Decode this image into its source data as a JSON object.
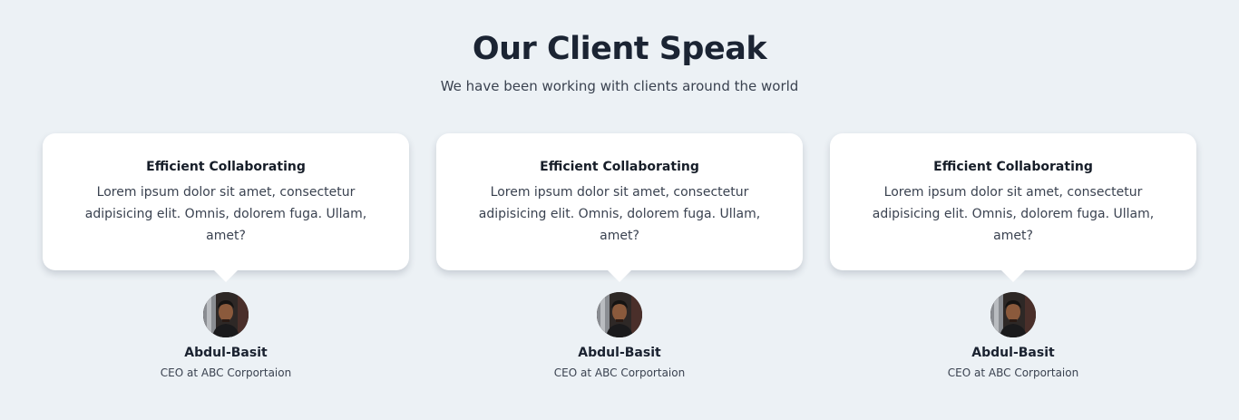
{
  "header": {
    "title": "Our Client Speak",
    "subtitle": "We have been working with clients around the world"
  },
  "testimonials": [
    {
      "heading": "Efficient Collaborating",
      "quote": "Lorem ipsum dolor sit amet, consectetur adipisicing elit. Omnis, dolorem fuga. Ullam, amet?",
      "name": "Abdul-Basit",
      "role": "CEO at ABC Corportaion"
    },
    {
      "heading": "Efficient Collaborating",
      "quote": "Lorem ipsum dolor sit amet, consectetur adipisicing elit. Omnis, dolorem fuga. Ullam, amet?",
      "name": "Abdul-Basit",
      "role": "CEO at ABC Corportaion"
    },
    {
      "heading": "Efficient Collaborating",
      "quote": "Lorem ipsum dolor sit amet, consectetur adipisicing elit. Omnis, dolorem fuga. Ullam, amet?",
      "name": "Abdul-Basit",
      "role": "CEO at ABC Corportaion"
    }
  ],
  "colors": {
    "background": "#ecf1f5",
    "card": "#ffffff",
    "heading": "#1b2433",
    "text": "#3a4250"
  }
}
